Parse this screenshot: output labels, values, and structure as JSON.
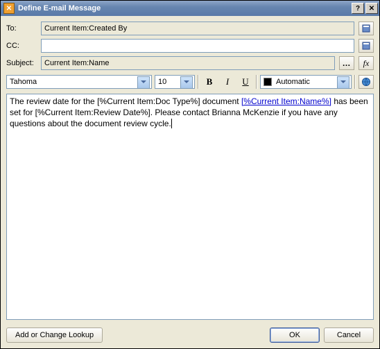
{
  "titlebar": {
    "title": "Define E-mail Message"
  },
  "header": {
    "to_label": "To:",
    "to_value": "Current Item:Created By",
    "cc_label": "CC:",
    "cc_value": "",
    "subject_label": "Subject:",
    "subject_value": "Current Item:Name",
    "more_btn": "…",
    "fx_btn": "fx"
  },
  "toolbar": {
    "font": "Tahoma",
    "size": "10",
    "bold": "B",
    "italic": "I",
    "underline": "U",
    "color_label": "Automatic"
  },
  "body": {
    "text_before_link": "The review date for the [%Current Item:Doc Type%] document ",
    "link_text": "[%Current Item:Name%]",
    "text_after_link": " has been set for [%Current Item:Review Date%]. Please contact Brianna McKenzie if you have any questions about the document review cycle."
  },
  "buttons": {
    "lookup": "Add or Change Lookup",
    "ok": "OK",
    "cancel": "Cancel"
  }
}
